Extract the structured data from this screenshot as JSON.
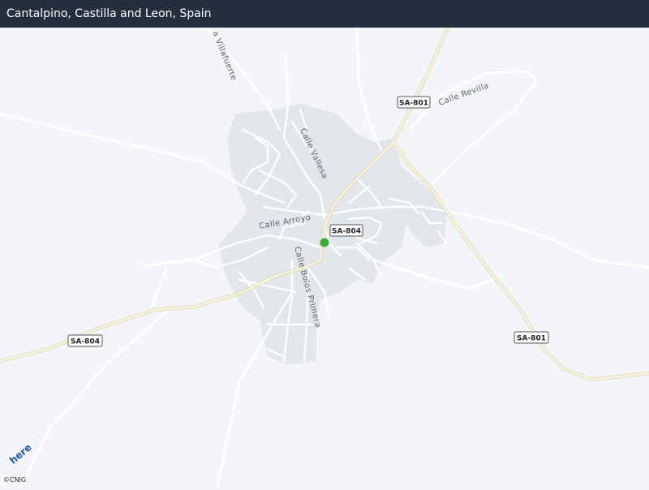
{
  "header": {
    "title": "Cantalpino, Castilla and Leon, Spain"
  },
  "map": {
    "streets": {
      "vallesa": "Calle Vallesa",
      "arroyo": "Calle Arroyo",
      "bolos_primera": "Calle Bolos Primera",
      "revilla": "Calle Revilla",
      "villafuerte": "a Villafuerte"
    },
    "shields": {
      "sa801_top": "SA-801",
      "sa801_right": "SA-801",
      "sa804_center": "SA-804",
      "sa804_left": "SA-804"
    },
    "marker": {
      "color": "#3aa935"
    }
  },
  "footer": {
    "logo": "here",
    "copyright": "©CNIG"
  },
  "colors": {
    "header_bg": "#232f3d",
    "map_bg": "#f3f5f8",
    "builtup": "#e2e7ec",
    "main_road": "#f3efd6"
  }
}
